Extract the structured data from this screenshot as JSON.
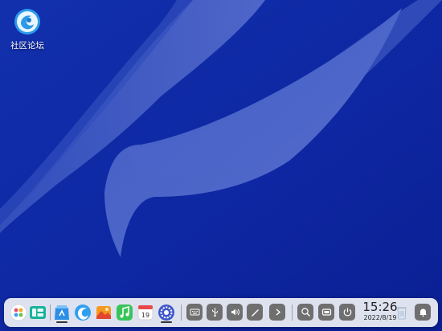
{
  "desktop": {
    "icons": [
      {
        "label": "社区论坛",
        "icon": "deepin-forum-icon"
      }
    ]
  },
  "dock": {
    "apps": [
      {
        "icon": "launcher-icon"
      },
      {
        "icon": "multitask-view-icon"
      },
      {
        "icon": "file-manager-icon",
        "running": true
      },
      {
        "icon": "browser-icon"
      },
      {
        "icon": "image-viewer-icon"
      },
      {
        "icon": "music-icon"
      },
      {
        "icon": "calendar-icon",
        "text": "19"
      },
      {
        "icon": "control-center-icon",
        "running": true
      }
    ],
    "tray": [
      {
        "icon": "keyboard-icon"
      },
      {
        "icon": "usb-icon"
      },
      {
        "icon": "volume-icon"
      },
      {
        "icon": "screen-brush-icon"
      },
      {
        "icon": "expand-arrow-icon"
      }
    ],
    "clock": {
      "time": "15:26",
      "date": "2022/8/19"
    }
  },
  "colors": {
    "wallpaper_dark": "#0b229c",
    "wallpaper_light": "#4e66c8",
    "dock_bg": "#eceef4",
    "tray_bg": "#6f6f6f"
  }
}
